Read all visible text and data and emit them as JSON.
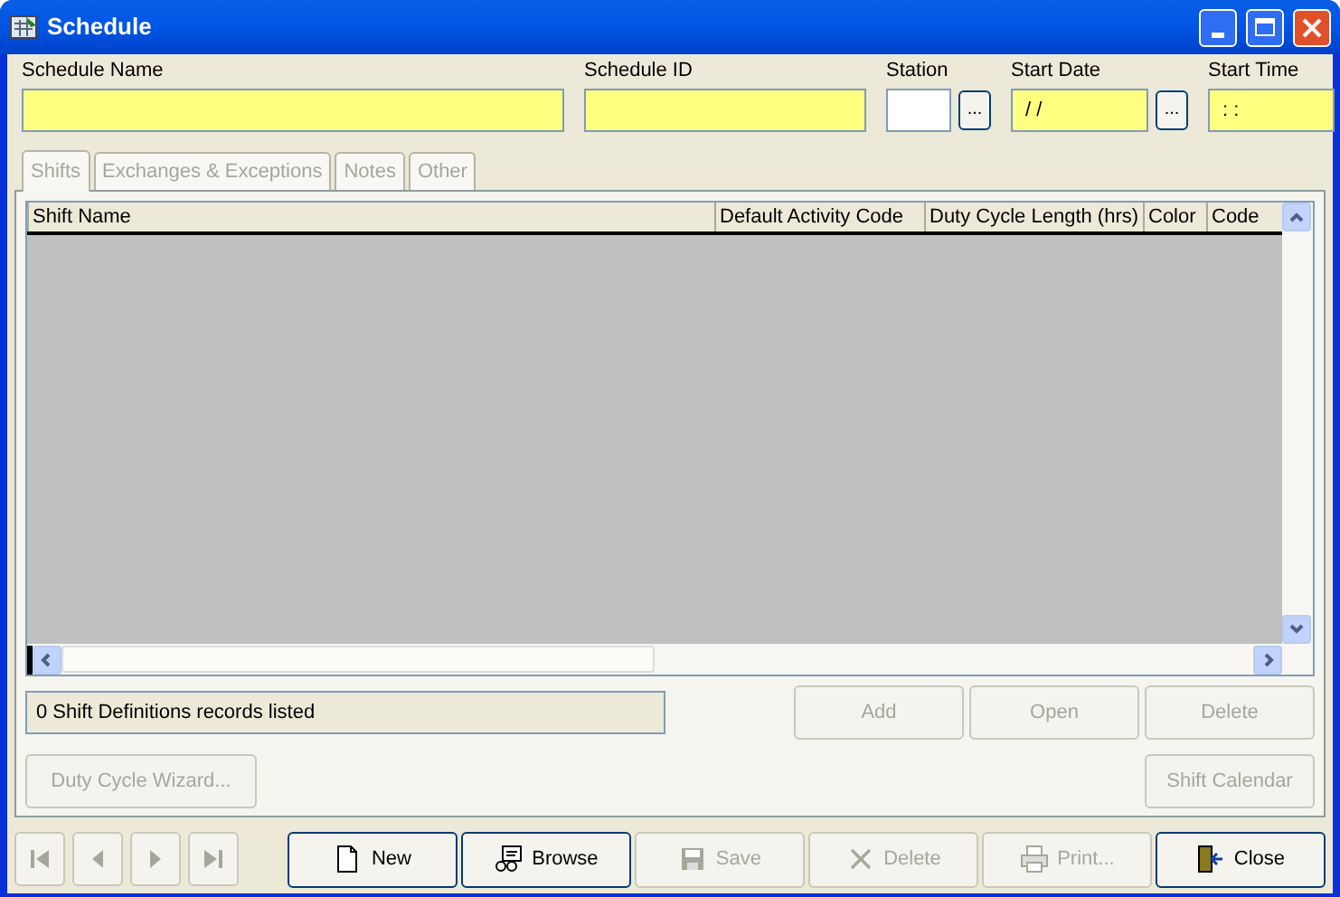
{
  "window": {
    "title": "Schedule"
  },
  "fields": [
    {
      "label": "Schedule Name",
      "required": true
    },
    {
      "label": "Schedule ID",
      "required": true
    },
    {
      "label": "Station",
      "required": false,
      "picker_label": "..."
    },
    {
      "label": "Start Date",
      "value": " / /",
      "required": true,
      "picker_label": "..."
    },
    {
      "label": "Start Time",
      "value": " : :",
      "required": true
    }
  ],
  "tabs": [
    {
      "label": "Shifts",
      "selected": true,
      "disabled": true
    },
    {
      "label": "Exchanges & Exceptions",
      "selected": false,
      "disabled": true
    },
    {
      "label": "Notes",
      "selected": false,
      "disabled": true
    },
    {
      "label": "Other",
      "selected": false,
      "disabled": true
    }
  ],
  "table": {
    "columns": [
      "Shift Name",
      "Default Activity Code",
      "Duty Cycle Length (hrs)",
      "Color",
      "Code"
    ]
  },
  "status": "0 Shift Definitions records listed",
  "row_buttons": [
    {
      "label": "Add",
      "disabled": true
    },
    {
      "label": "Open",
      "disabled": true
    },
    {
      "label": "Delete",
      "disabled": true
    }
  ],
  "wizard_button": {
    "label": "Duty Cycle Wizard...",
    "disabled": true
  },
  "calendar_button": {
    "label": "Shift Calendar",
    "disabled": true
  },
  "nav_buttons": [
    {
      "kind": "first",
      "disabled": true
    },
    {
      "kind": "prev",
      "disabled": true
    },
    {
      "kind": "next",
      "disabled": true
    },
    {
      "kind": "last",
      "disabled": true
    }
  ],
  "toolbar": [
    {
      "kind": "new",
      "label": "New",
      "disabled": false
    },
    {
      "kind": "browse",
      "label": "Browse",
      "disabled": false
    },
    {
      "kind": "save",
      "label": "Save",
      "disabled": true
    },
    {
      "kind": "delete",
      "label": "Delete",
      "disabled": true
    },
    {
      "kind": "print",
      "label": "Print...",
      "disabled": true
    },
    {
      "kind": "close",
      "label": "Close",
      "disabled": false
    }
  ]
}
